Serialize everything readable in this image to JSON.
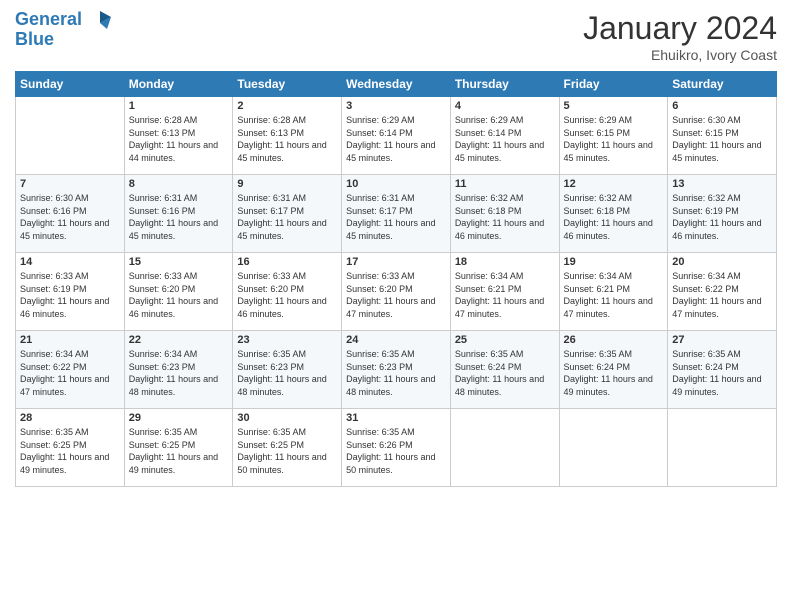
{
  "logo": {
    "line1": "General",
    "line2": "Blue"
  },
  "title": "January 2024",
  "location": "Ehuikro, Ivory Coast",
  "days_of_week": [
    "Sunday",
    "Monday",
    "Tuesday",
    "Wednesday",
    "Thursday",
    "Friday",
    "Saturday"
  ],
  "weeks": [
    [
      {
        "day": "",
        "sunrise": "",
        "sunset": "",
        "daylight": ""
      },
      {
        "day": "1",
        "sunrise": "Sunrise: 6:28 AM",
        "sunset": "Sunset: 6:13 PM",
        "daylight": "Daylight: 11 hours and 44 minutes."
      },
      {
        "day": "2",
        "sunrise": "Sunrise: 6:28 AM",
        "sunset": "Sunset: 6:13 PM",
        "daylight": "Daylight: 11 hours and 45 minutes."
      },
      {
        "day": "3",
        "sunrise": "Sunrise: 6:29 AM",
        "sunset": "Sunset: 6:14 PM",
        "daylight": "Daylight: 11 hours and 45 minutes."
      },
      {
        "day": "4",
        "sunrise": "Sunrise: 6:29 AM",
        "sunset": "Sunset: 6:14 PM",
        "daylight": "Daylight: 11 hours and 45 minutes."
      },
      {
        "day": "5",
        "sunrise": "Sunrise: 6:29 AM",
        "sunset": "Sunset: 6:15 PM",
        "daylight": "Daylight: 11 hours and 45 minutes."
      },
      {
        "day": "6",
        "sunrise": "Sunrise: 6:30 AM",
        "sunset": "Sunset: 6:15 PM",
        "daylight": "Daylight: 11 hours and 45 minutes."
      }
    ],
    [
      {
        "day": "7",
        "sunrise": "Sunrise: 6:30 AM",
        "sunset": "Sunset: 6:16 PM",
        "daylight": "Daylight: 11 hours and 45 minutes."
      },
      {
        "day": "8",
        "sunrise": "Sunrise: 6:31 AM",
        "sunset": "Sunset: 6:16 PM",
        "daylight": "Daylight: 11 hours and 45 minutes."
      },
      {
        "day": "9",
        "sunrise": "Sunrise: 6:31 AM",
        "sunset": "Sunset: 6:17 PM",
        "daylight": "Daylight: 11 hours and 45 minutes."
      },
      {
        "day": "10",
        "sunrise": "Sunrise: 6:31 AM",
        "sunset": "Sunset: 6:17 PM",
        "daylight": "Daylight: 11 hours and 45 minutes."
      },
      {
        "day": "11",
        "sunrise": "Sunrise: 6:32 AM",
        "sunset": "Sunset: 6:18 PM",
        "daylight": "Daylight: 11 hours and 46 minutes."
      },
      {
        "day": "12",
        "sunrise": "Sunrise: 6:32 AM",
        "sunset": "Sunset: 6:18 PM",
        "daylight": "Daylight: 11 hours and 46 minutes."
      },
      {
        "day": "13",
        "sunrise": "Sunrise: 6:32 AM",
        "sunset": "Sunset: 6:19 PM",
        "daylight": "Daylight: 11 hours and 46 minutes."
      }
    ],
    [
      {
        "day": "14",
        "sunrise": "Sunrise: 6:33 AM",
        "sunset": "Sunset: 6:19 PM",
        "daylight": "Daylight: 11 hours and 46 minutes."
      },
      {
        "day": "15",
        "sunrise": "Sunrise: 6:33 AM",
        "sunset": "Sunset: 6:20 PM",
        "daylight": "Daylight: 11 hours and 46 minutes."
      },
      {
        "day": "16",
        "sunrise": "Sunrise: 6:33 AM",
        "sunset": "Sunset: 6:20 PM",
        "daylight": "Daylight: 11 hours and 46 minutes."
      },
      {
        "day": "17",
        "sunrise": "Sunrise: 6:33 AM",
        "sunset": "Sunset: 6:20 PM",
        "daylight": "Daylight: 11 hours and 47 minutes."
      },
      {
        "day": "18",
        "sunrise": "Sunrise: 6:34 AM",
        "sunset": "Sunset: 6:21 PM",
        "daylight": "Daylight: 11 hours and 47 minutes."
      },
      {
        "day": "19",
        "sunrise": "Sunrise: 6:34 AM",
        "sunset": "Sunset: 6:21 PM",
        "daylight": "Daylight: 11 hours and 47 minutes."
      },
      {
        "day": "20",
        "sunrise": "Sunrise: 6:34 AM",
        "sunset": "Sunset: 6:22 PM",
        "daylight": "Daylight: 11 hours and 47 minutes."
      }
    ],
    [
      {
        "day": "21",
        "sunrise": "Sunrise: 6:34 AM",
        "sunset": "Sunset: 6:22 PM",
        "daylight": "Daylight: 11 hours and 47 minutes."
      },
      {
        "day": "22",
        "sunrise": "Sunrise: 6:34 AM",
        "sunset": "Sunset: 6:23 PM",
        "daylight": "Daylight: 11 hours and 48 minutes."
      },
      {
        "day": "23",
        "sunrise": "Sunrise: 6:35 AM",
        "sunset": "Sunset: 6:23 PM",
        "daylight": "Daylight: 11 hours and 48 minutes."
      },
      {
        "day": "24",
        "sunrise": "Sunrise: 6:35 AM",
        "sunset": "Sunset: 6:23 PM",
        "daylight": "Daylight: 11 hours and 48 minutes."
      },
      {
        "day": "25",
        "sunrise": "Sunrise: 6:35 AM",
        "sunset": "Sunset: 6:24 PM",
        "daylight": "Daylight: 11 hours and 48 minutes."
      },
      {
        "day": "26",
        "sunrise": "Sunrise: 6:35 AM",
        "sunset": "Sunset: 6:24 PM",
        "daylight": "Daylight: 11 hours and 49 minutes."
      },
      {
        "day": "27",
        "sunrise": "Sunrise: 6:35 AM",
        "sunset": "Sunset: 6:24 PM",
        "daylight": "Daylight: 11 hours and 49 minutes."
      }
    ],
    [
      {
        "day": "28",
        "sunrise": "Sunrise: 6:35 AM",
        "sunset": "Sunset: 6:25 PM",
        "daylight": "Daylight: 11 hours and 49 minutes."
      },
      {
        "day": "29",
        "sunrise": "Sunrise: 6:35 AM",
        "sunset": "Sunset: 6:25 PM",
        "daylight": "Daylight: 11 hours and 49 minutes."
      },
      {
        "day": "30",
        "sunrise": "Sunrise: 6:35 AM",
        "sunset": "Sunset: 6:25 PM",
        "daylight": "Daylight: 11 hours and 50 minutes."
      },
      {
        "day": "31",
        "sunrise": "Sunrise: 6:35 AM",
        "sunset": "Sunset: 6:26 PM",
        "daylight": "Daylight: 11 hours and 50 minutes."
      },
      {
        "day": "",
        "sunrise": "",
        "sunset": "",
        "daylight": ""
      },
      {
        "day": "",
        "sunrise": "",
        "sunset": "",
        "daylight": ""
      },
      {
        "day": "",
        "sunrise": "",
        "sunset": "",
        "daylight": ""
      }
    ]
  ]
}
